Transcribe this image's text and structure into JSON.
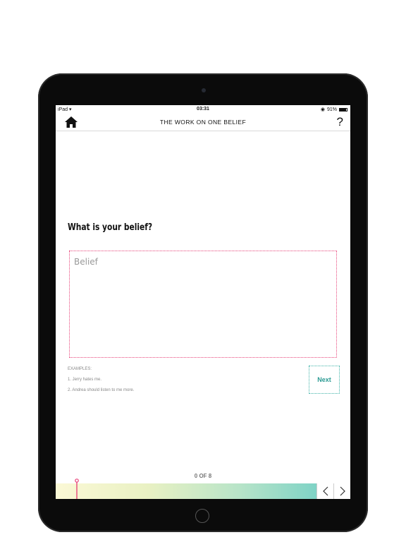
{
  "device": {
    "frame_color": "#0b0b0b"
  },
  "status_bar": {
    "carrier": "iPad",
    "time": "03:31",
    "battery": "91%"
  },
  "nav": {
    "title": "THE WORK ON ONE BELIEF",
    "help_label": "?"
  },
  "question": "What is your belief?",
  "belief_field": {
    "placeholder": "Belief",
    "value": ""
  },
  "examples": {
    "heading": "EXAMPLES:",
    "items": [
      "1. Jerry hates me.",
      "2. Andrea should listen to me more."
    ]
  },
  "next_label": "Next",
  "progress": {
    "label": "0 OF 8",
    "current": 0,
    "total": 8
  },
  "colors": {
    "accent_pink": "#e8447a",
    "accent_teal": "#2a9a93"
  }
}
